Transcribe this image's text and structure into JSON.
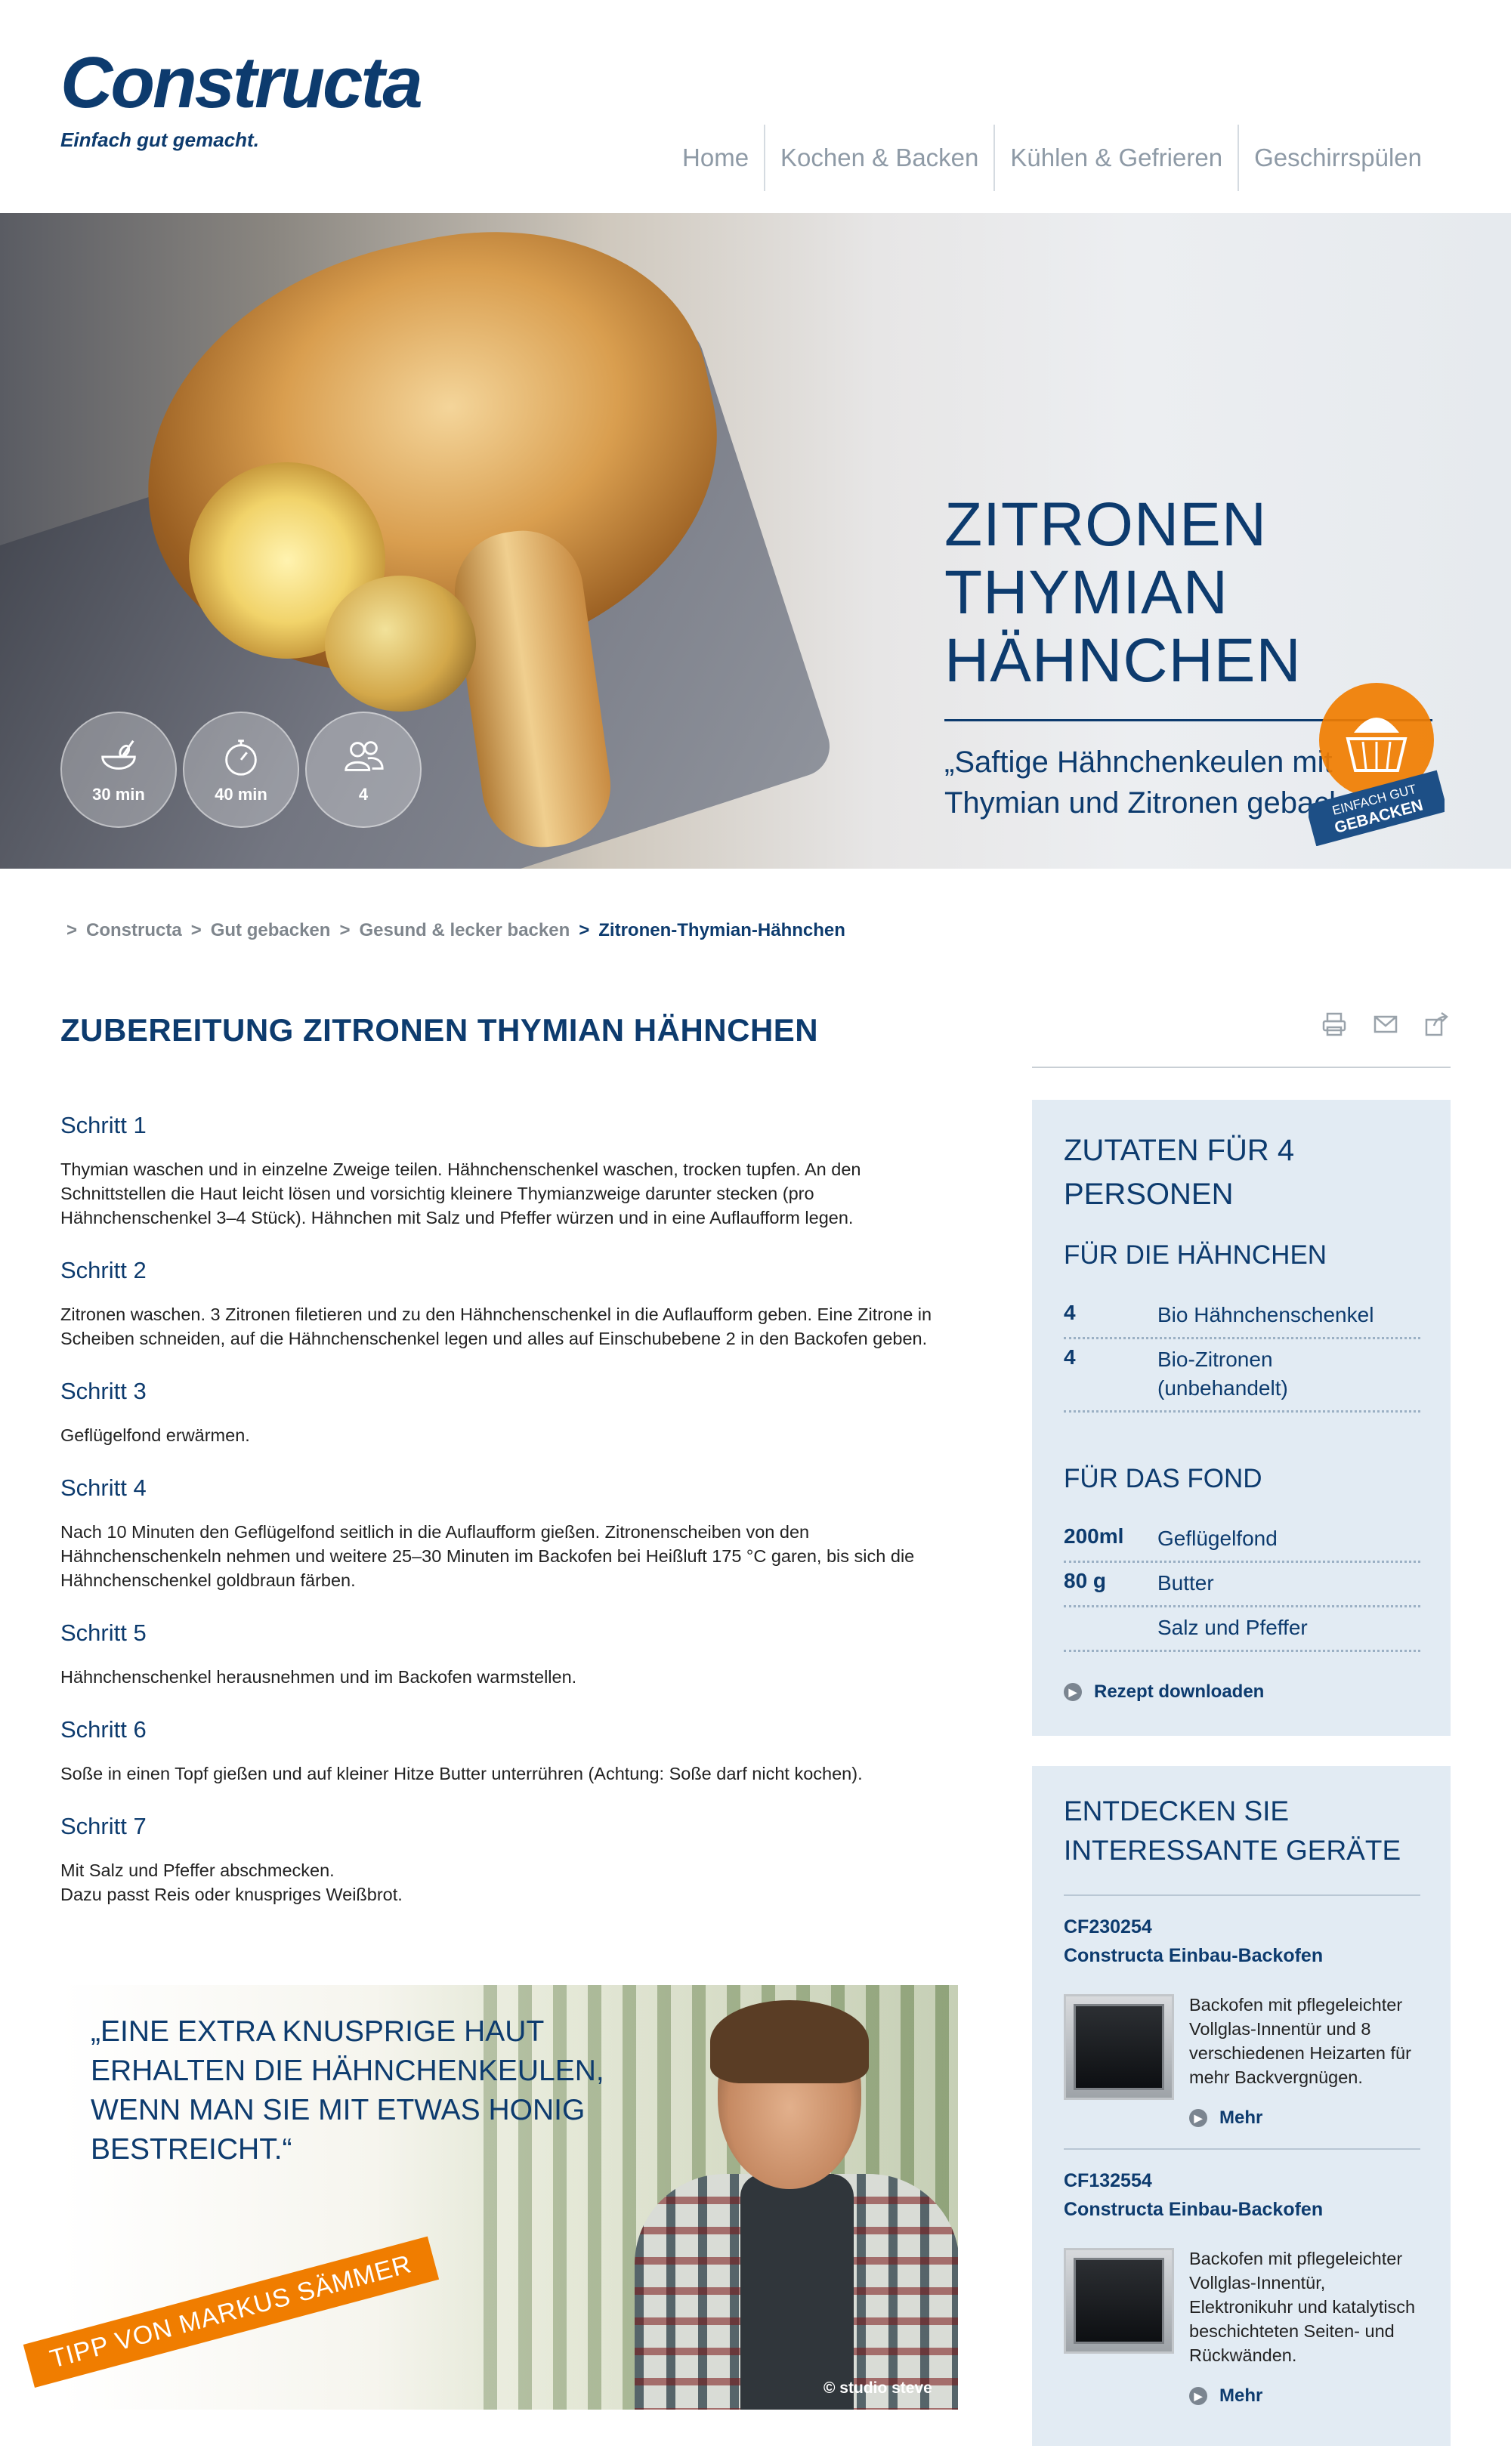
{
  "header": {
    "logo_text": "Constructa",
    "tagline": "Einfach gut gemacht.",
    "nav": [
      "Home",
      "Kochen & Backen",
      "Kühlen & Gefrieren",
      "Geschirrspülen"
    ]
  },
  "hero": {
    "title_lines": [
      "ZITRONEN",
      "THYMIAN",
      "HÄHNCHEN"
    ],
    "quote_lines": [
      "„Saftige Hähnchenkeulen mit",
      "Thymian und Zitronen gebacken.“"
    ],
    "stats": [
      {
        "icon": "bowl-whisk-icon",
        "label": "30 min"
      },
      {
        "icon": "stopwatch-icon",
        "label": "40 min"
      },
      {
        "icon": "people-icon",
        "label": "4"
      }
    ],
    "badge": {
      "line1": "EINFACH GUT",
      "line2": "GEBACKEN"
    }
  },
  "breadcrumb": {
    "items": [
      "Constructa",
      "Gut gebacken",
      "Gesund & lecker backen",
      "Zitronen-Thymian-Hähnchen"
    ]
  },
  "main": {
    "title": "ZUBEREITUNG ZITRONEN THYMIAN HÄHNCHEN",
    "steps": [
      {
        "title": "Schritt 1",
        "lines": [
          "Thymian waschen und in einzelne Zweige teilen. Hähnchenschenkel waschen, trocken tupfen. An den",
          "Schnittstellen die Haut leicht lösen und vorsichtig kleinere Thymianzweige darunter stecken (pro",
          "Hähnchenschenkel 3–4 Stück). Hähnchen mit Salz und Pfeffer würzen und in eine Auflaufform legen."
        ]
      },
      {
        "title": "Schritt 2",
        "lines": [
          "Zitronen waschen. 3 Zitronen filetieren und zu den Hähnchenschenkel in die Auflaufform geben. Eine Zitrone in",
          "Scheiben schneiden, auf die Hähnchenschenkel legen und alles auf Einschubebene 2 in den Backofen geben."
        ]
      },
      {
        "title": "Schritt 3",
        "lines": [
          "Geflügelfond erwärmen."
        ]
      },
      {
        "title": "Schritt 4",
        "lines": [
          "Nach 10 Minuten den Geflügelfond seitlich in die Auflaufform gießen. Zitronenscheiben von den",
          "Hähnchenschenkeln nehmen und weitere 25–30 Minuten im Backofen bei Heißluft 175 °C garen, bis sich die",
          "Hähnchenschenkel goldbraun färben."
        ]
      },
      {
        "title": "Schritt 5",
        "lines": [
          "Hähnchenschenkel herausnehmen und im Backofen warmstellen."
        ]
      },
      {
        "title": "Schritt 6",
        "lines": [
          "Soße in einen Topf gießen und auf kleiner Hitze Butter unterrühren (Achtung: Soße darf nicht kochen)."
        ]
      },
      {
        "title": "Schritt 7",
        "lines": [
          "Mit Salz und Pfeffer abschmecken.",
          "Dazu passt Reis oder knuspriges Weißbrot."
        ]
      }
    ],
    "tip": {
      "quote_lines": [
        "„EINE EXTRA KNUSPRIGE HAUT",
        "ERHALTEN DIE HÄHNCHENKEULEN,",
        "WENN MAN SIE MIT ETWAS HONIG",
        "BESTREICHT.“"
      ],
      "ribbon": "TIPP VON MARKUS SÄMMER",
      "credit": "© studio steve"
    }
  },
  "sidebar": {
    "ingredients": {
      "title_lines": [
        "ZUTATEN FÜR 4",
        "PERSONEN"
      ],
      "groups": [
        {
          "title": "FÜR DIE HÄHNCHEN",
          "items": [
            {
              "qty": "4",
              "name": "Bio Hähnchenschenkel"
            },
            {
              "qty": "4",
              "name": "Bio-Zitronen (unbehandelt)"
            }
          ]
        },
        {
          "title": "FÜR DAS FOND",
          "items": [
            {
              "qty": "200ml",
              "name": "Geflügelfond"
            },
            {
              "qty": "80 g",
              "name": "Butter"
            },
            {
              "qty": "",
              "name": "Salz und Pfeffer"
            }
          ]
        }
      ],
      "download": "Rezept downloaden"
    },
    "devices": {
      "title_lines": [
        "ENTDECKEN SIE",
        "INTERESSANTE GERÄTE"
      ],
      "items": [
        {
          "model": "CF230254",
          "name": "Constructa Einbau-Backofen",
          "text_lines": [
            "Backofen mit pflegeleichter",
            "Vollglas-Innentür und 8",
            "verschiedenen Heizarten für",
            "mehr Backvergnügen."
          ],
          "more": "Mehr"
        },
        {
          "model": "CF132554",
          "name": "Constructa Einbau-Backofen",
          "text_lines": [
            "Backofen mit pflegeleichter",
            "Vollglas-Innentür,",
            "Elektronikuhr und katalytisch",
            "beschichteten Seiten- und",
            "Rückwänden."
          ],
          "more": "Mehr"
        }
      ]
    }
  },
  "colors": {
    "brand": "#0d3b6e",
    "panel": "#e2ebf3",
    "accent": "#f07d00"
  }
}
